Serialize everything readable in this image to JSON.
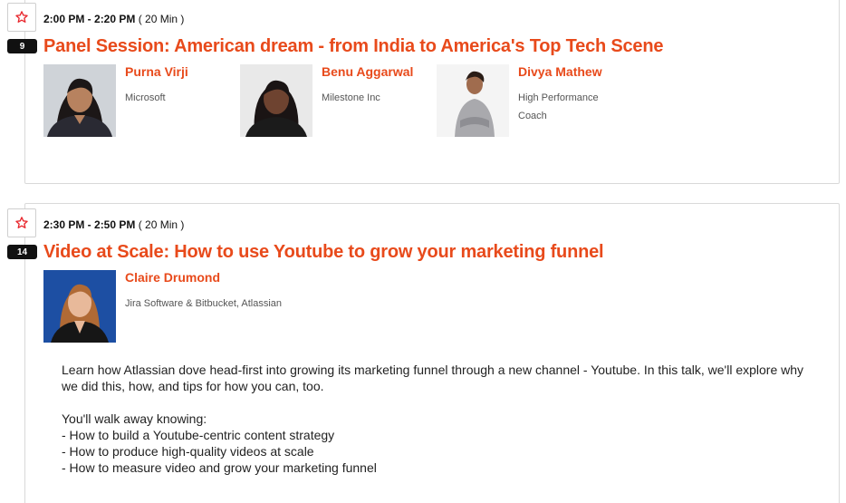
{
  "sessions": [
    {
      "number": "9",
      "time_range": "2:00 PM - 2:20 PM",
      "duration": "( 20 Min )",
      "title": "Panel Session: American dream - from India to America's Top Tech Scene",
      "speakers": [
        {
          "name": "Purna Virji",
          "org": "Microsoft"
        },
        {
          "name": "Benu Aggarwal",
          "org": "Milestone Inc"
        },
        {
          "name": "Divya Mathew",
          "org": "High Performance Coach"
        }
      ]
    },
    {
      "number": "14",
      "time_range": "2:30 PM - 2:50 PM",
      "duration": "( 20 Min )",
      "title": "Video at Scale: How to use Youtube to grow your marketing funnel",
      "speakers": [
        {
          "name": "Claire Drumond",
          "org": "Jira Software & Bitbucket, Atlassian"
        }
      ],
      "description": {
        "intro": "Learn how Atlassian dove head-first into growing its marketing funnel through a new channel - Youtube. In this talk, we'll explore why we did this, how, and tips for how you can, too.",
        "lead": "You'll walk away knowing:",
        "bullets": [
          "- How to build a Youtube-centric content strategy",
          "- How to produce high-quality videos at scale",
          "- How to measure video and grow your marketing funnel"
        ]
      }
    }
  ],
  "icons": {
    "favorite": "star-outline-icon"
  },
  "colors": {
    "accent": "#e84a1b",
    "badge": "#111111",
    "border": "#d9d9d9"
  }
}
